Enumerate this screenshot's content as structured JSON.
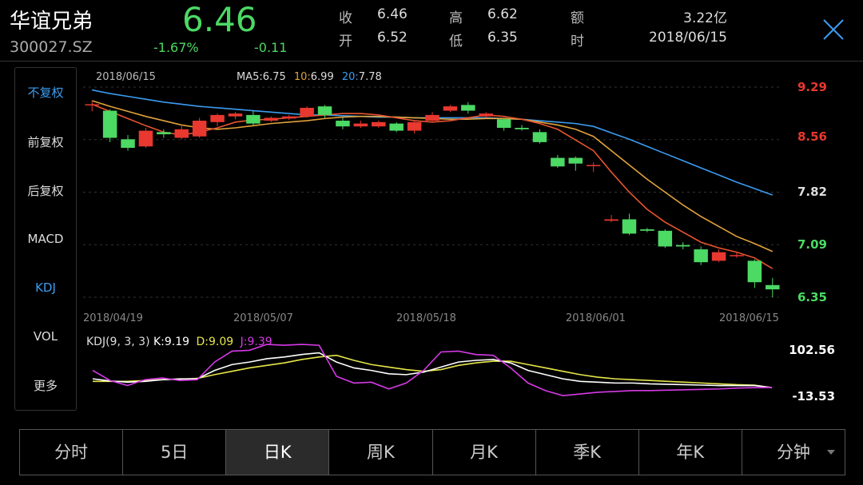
{
  "header": {
    "name": "华谊兄弟",
    "code": "300027.SZ",
    "price": "6.46",
    "change_pct": "-1.67%",
    "change": "-0.11",
    "stats": [
      {
        "label": "收",
        "value": "6.46"
      },
      {
        "label": "开",
        "value": "6.52"
      },
      {
        "label": "高",
        "value": "6.62"
      },
      {
        "label": "低",
        "value": "6.35"
      },
      {
        "label": "额",
        "value": "3.22亿"
      },
      {
        "label": "时",
        "value": "2018/06/15"
      }
    ],
    "close_icon": "close-icon"
  },
  "side_menu": [
    {
      "label": "不复权",
      "active": true
    },
    {
      "label": "前复权",
      "active": false
    },
    {
      "label": "后复权",
      "active": false
    },
    {
      "label": "MACD",
      "active": false
    },
    {
      "label": "KDJ",
      "active": true
    },
    {
      "label": "VOL",
      "active": false
    },
    {
      "label": "更多",
      "active": false
    }
  ],
  "main_chart": {
    "date": "2018/06/15",
    "ma5_key": "MA5:",
    "ma5_val": "6.75",
    "ma10_key": "10:",
    "ma10_val": "6.99",
    "ma20_key": "20:",
    "ma20_val": "7.78",
    "y_ticks": [
      "9.29",
      "8.56",
      "7.82",
      "7.09",
      "6.35"
    ],
    "x_ticks": [
      "2018/04/19",
      "2018/05/07",
      "2018/05/18",
      "2018/06/01",
      "2018/06/15"
    ]
  },
  "kdj_chart": {
    "label": "KDJ(9, 3, 3)",
    "k": "K:9.19",
    "d": "D:9.09",
    "j": "J:9.39",
    "y_max": "102.56",
    "y_min": "-13.53"
  },
  "colors": {
    "up": "#e8382f",
    "down": "#4cd964",
    "ma5": "#e8552f",
    "ma10": "#e0a23a",
    "ma20": "#3b9cf0",
    "k": "#ffffff",
    "d": "#e6e64a",
    "j": "#d63ae6"
  },
  "chart_data": {
    "type": "candlestick",
    "ylim": [
      6.35,
      9.29
    ],
    "candles": [
      {
        "o": 9.05,
        "c": 9.05,
        "h": 9.1,
        "l": 8.95
      },
      {
        "o": 8.96,
        "c": 8.58,
        "h": 8.98,
        "l": 8.52
      },
      {
        "o": 8.56,
        "c": 8.44,
        "h": 8.62,
        "l": 8.4
      },
      {
        "o": 8.46,
        "c": 8.68,
        "h": 8.72,
        "l": 8.44
      },
      {
        "o": 8.66,
        "c": 8.63,
        "h": 8.7,
        "l": 8.58
      },
      {
        "o": 8.58,
        "c": 8.7,
        "h": 8.76,
        "l": 8.56
      },
      {
        "o": 8.6,
        "c": 8.82,
        "h": 8.86,
        "l": 8.58
      },
      {
        "o": 8.8,
        "c": 8.9,
        "h": 8.92,
        "l": 8.74
      },
      {
        "o": 8.88,
        "c": 8.92,
        "h": 8.94,
        "l": 8.84
      },
      {
        "o": 8.9,
        "c": 8.78,
        "h": 8.96,
        "l": 8.76
      },
      {
        "o": 8.82,
        "c": 8.86,
        "h": 8.88,
        "l": 8.8
      },
      {
        "o": 8.85,
        "c": 8.88,
        "h": 8.9,
        "l": 8.83
      },
      {
        "o": 8.88,
        "c": 9.0,
        "h": 9.02,
        "l": 8.86
      },
      {
        "o": 9.02,
        "c": 8.9,
        "h": 9.04,
        "l": 8.86
      },
      {
        "o": 8.82,
        "c": 8.74,
        "h": 8.86,
        "l": 8.7
      },
      {
        "o": 8.74,
        "c": 8.78,
        "h": 8.82,
        "l": 8.72
      },
      {
        "o": 8.74,
        "c": 8.8,
        "h": 8.82,
        "l": 8.72
      },
      {
        "o": 8.78,
        "c": 8.68,
        "h": 8.8,
        "l": 8.66
      },
      {
        "o": 8.68,
        "c": 8.8,
        "h": 8.82,
        "l": 8.64
      },
      {
        "o": 8.82,
        "c": 8.9,
        "h": 8.94,
        "l": 8.8
      },
      {
        "o": 8.96,
        "c": 9.02,
        "h": 9.04,
        "l": 8.94
      },
      {
        "o": 9.04,
        "c": 8.96,
        "h": 9.08,
        "l": 8.92
      },
      {
        "o": 8.88,
        "c": 8.92,
        "h": 8.94,
        "l": 8.86
      },
      {
        "o": 8.84,
        "c": 8.72,
        "h": 8.86,
        "l": 8.68
      },
      {
        "o": 8.72,
        "c": 8.7,
        "h": 8.76,
        "l": 8.68
      },
      {
        "o": 8.66,
        "c": 8.52,
        "h": 8.7,
        "l": 8.5
      },
      {
        "o": 8.3,
        "c": 8.18,
        "h": 8.34,
        "l": 8.16
      },
      {
        "o": 8.3,
        "c": 8.22,
        "h": 8.32,
        "l": 8.12
      },
      {
        "o": 8.2,
        "c": 8.2,
        "h": 8.24,
        "l": 8.1
      },
      {
        "o": 7.42,
        "c": 7.44,
        "h": 7.5,
        "l": 7.4
      },
      {
        "o": 7.44,
        "c": 7.24,
        "h": 7.52,
        "l": 7.22
      },
      {
        "o": 7.3,
        "c": 7.28,
        "h": 7.32,
        "l": 7.26
      },
      {
        "o": 7.28,
        "c": 7.06,
        "h": 7.3,
        "l": 7.04
      },
      {
        "o": 7.08,
        "c": 7.06,
        "h": 7.12,
        "l": 7.02
      },
      {
        "o": 7.02,
        "c": 6.84,
        "h": 7.06,
        "l": 6.8
      },
      {
        "o": 6.86,
        "c": 6.98,
        "h": 7.02,
        "l": 6.84
      },
      {
        "o": 6.94,
        "c": 6.94,
        "h": 6.98,
        "l": 6.9
      },
      {
        "o": 6.86,
        "c": 6.56,
        "h": 6.88,
        "l": 6.48
      },
      {
        "o": 6.52,
        "c": 6.46,
        "h": 6.62,
        "l": 6.35
      }
    ],
    "ma5": [
      9.05,
      8.95,
      8.85,
      8.75,
      8.66,
      8.62,
      8.66,
      8.72,
      8.8,
      8.83,
      8.84,
      8.86,
      8.88,
      8.9,
      8.92,
      8.92,
      8.9,
      8.86,
      8.82,
      8.8,
      8.82,
      8.86,
      8.9,
      8.88,
      8.84,
      8.78,
      8.7,
      8.55,
      8.4,
      8.1,
      7.82,
      7.58,
      7.4,
      7.26,
      7.12,
      7.04,
      6.98,
      6.9,
      6.75
    ],
    "ma10": [
      9.1,
      9.02,
      8.95,
      8.88,
      8.82,
      8.76,
      8.72,
      8.7,
      8.72,
      8.75,
      8.78,
      8.8,
      8.82,
      8.85,
      8.87,
      8.88,
      8.88,
      8.87,
      8.86,
      8.85,
      8.84,
      8.84,
      8.85,
      8.85,
      8.84,
      8.8,
      8.76,
      8.7,
      8.6,
      8.4,
      8.2,
      8.0,
      7.82,
      7.64,
      7.48,
      7.34,
      7.2,
      7.1,
      6.99
    ],
    "ma20": [
      9.25,
      9.2,
      9.16,
      9.12,
      9.08,
      9.05,
      9.02,
      9.0,
      8.98,
      8.96,
      8.94,
      8.92,
      8.9,
      8.9,
      8.89,
      8.88,
      8.87,
      8.87,
      8.86,
      8.86,
      8.86,
      8.86,
      8.86,
      8.85,
      8.84,
      8.82,
      8.8,
      8.78,
      8.74,
      8.65,
      8.56,
      8.46,
      8.36,
      8.26,
      8.16,
      8.06,
      7.96,
      7.87,
      7.78
    ],
    "kdj": {
      "ylim": [
        -13.53,
        102.56
      ],
      "k": [
        30,
        25,
        22,
        24,
        28,
        30,
        30,
        50,
        64,
        70,
        78,
        82,
        88,
        92,
        70,
        56,
        50,
        42,
        40,
        46,
        58,
        70,
        74,
        76,
        68,
        50,
        40,
        30,
        24,
        22,
        20,
        20,
        18,
        17,
        16,
        15,
        14,
        14,
        14,
        9.19
      ],
      "d": [
        24,
        24,
        24,
        26,
        28,
        29,
        31,
        40,
        48,
        56,
        62,
        68,
        76,
        82,
        86,
        74,
        64,
        58,
        52,
        48,
        52,
        62,
        68,
        72,
        72,
        64,
        56,
        48,
        40,
        34,
        30,
        28,
        26,
        24,
        22,
        20,
        18,
        16,
        15,
        9.09
      ],
      "j": [
        50,
        26,
        14,
        28,
        32,
        26,
        28,
        70,
        96,
        98,
        112,
        110,
        112,
        110,
        36,
        20,
        22,
        6,
        20,
        50,
        94,
        96,
        88,
        86,
        56,
        20,
        2,
        -10,
        -6,
        -2,
        0,
        2,
        2,
        3,
        4,
        5,
        6,
        8,
        9,
        9.39
      ]
    }
  }
}
